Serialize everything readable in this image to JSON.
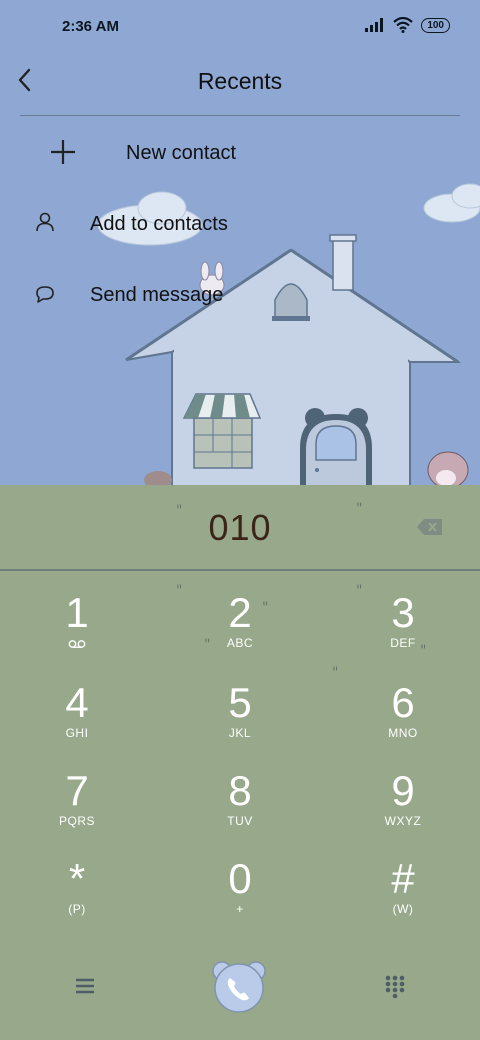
{
  "status": {
    "time": "2:36 AM",
    "battery": "100"
  },
  "header": {
    "title": "Recents"
  },
  "actions": [
    {
      "label": "New contact",
      "icon": "plus-icon"
    },
    {
      "label": "Add to contacts",
      "icon": "person-icon"
    },
    {
      "label": "Send message",
      "icon": "chat-bubble-icon"
    }
  ],
  "dialer": {
    "input": "010",
    "keys": [
      {
        "digit": "1",
        "letters": ""
      },
      {
        "digit": "2",
        "letters": "ABC"
      },
      {
        "digit": "3",
        "letters": "DEF"
      },
      {
        "digit": "4",
        "letters": "GHI"
      },
      {
        "digit": "5",
        "letters": "JKL"
      },
      {
        "digit": "6",
        "letters": "MNO"
      },
      {
        "digit": "7",
        "letters": "PQRS"
      },
      {
        "digit": "8",
        "letters": "TUV"
      },
      {
        "digit": "9",
        "letters": "WXYZ"
      },
      {
        "digit": "*",
        "letters": "(P)"
      },
      {
        "digit": "0",
        "letters": "+"
      },
      {
        "digit": "#",
        "letters": "(W)"
      }
    ]
  },
  "colors": {
    "sky": "#8ea8d3",
    "dialpad": "#97a98a",
    "call_button": "#b9cbe8"
  }
}
